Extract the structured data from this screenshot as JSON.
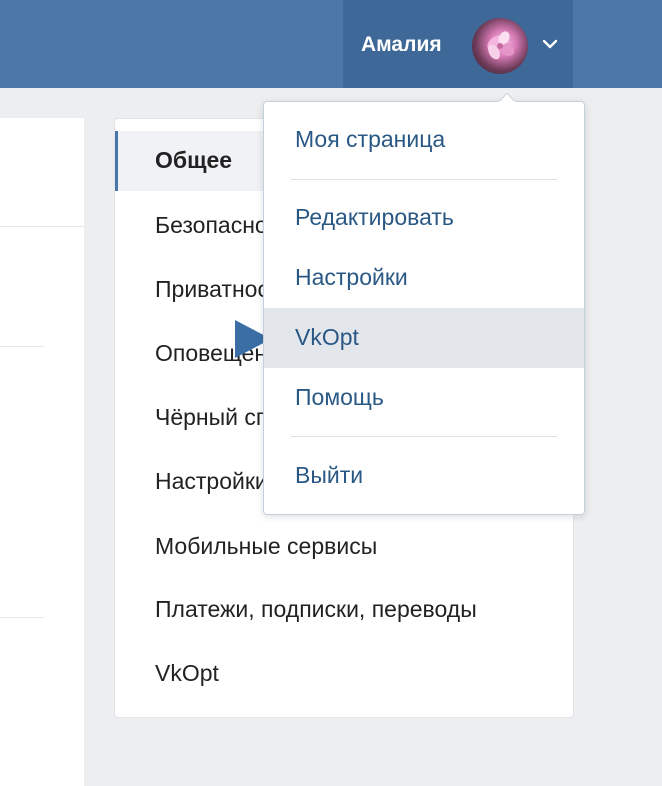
{
  "header": {
    "user_name": "Амалия",
    "avatar_icon": "user-avatar",
    "menu_toggle_icon": "chevron-down-icon"
  },
  "settings_nav": {
    "items": [
      {
        "label": "Общее",
        "active": true
      },
      {
        "label": "Безопасность",
        "active": false
      },
      {
        "label": "Приватность",
        "active": false
      },
      {
        "label": "Оповещения",
        "active": false
      },
      {
        "label": "Чёрный список",
        "active": false
      },
      {
        "label": "Настройки приложений",
        "active": false
      },
      {
        "label": "Мобильные сервисы",
        "active": false
      },
      {
        "label": "Платежи, подписки, переводы",
        "active": false
      },
      {
        "label": "VkOpt",
        "active": false
      }
    ]
  },
  "profile_menu": {
    "items": [
      {
        "label": "Моя страница",
        "highlighted": false
      },
      {
        "label": "Редактировать",
        "highlighted": false
      },
      {
        "label": "Настройки",
        "highlighted": false
      },
      {
        "label": "VkOpt",
        "highlighted": true
      },
      {
        "label": "Помощь",
        "highlighted": false
      },
      {
        "label": "Выйти",
        "highlighted": false
      }
    ]
  },
  "colors": {
    "header_bg": "#4a76a8",
    "header_user_bg": "#3d6898",
    "page_bg": "#edeef0",
    "link_text": "#2a5885",
    "pointer": "#3a6ea5"
  }
}
